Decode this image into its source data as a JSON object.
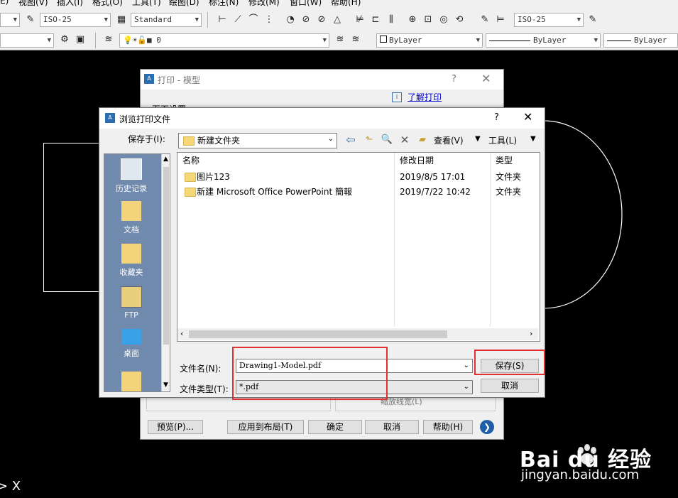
{
  "menu": {
    "items": [
      "E)",
      "视图(V)",
      "插入(I)",
      "格式(O)",
      "工具(T)",
      "绘图(D)",
      "标注(N)",
      "修改(M)",
      "窗口(W)",
      "帮助(H)"
    ]
  },
  "toolbar": {
    "text_style": "ISO-25",
    "table_style": "Standard",
    "dim_style": "ISO-25",
    "layer": "0",
    "color": "ByLayer",
    "linetype": "ByLayer",
    "lineweight": "ByLayer"
  },
  "print_dialog": {
    "title": "打印 - 模型",
    "help": "?",
    "learn_link": "了解打印",
    "partial_label": "页面设置",
    "partial_text": "缩放线宽(L)",
    "buttons": {
      "preview": "预览(P)...",
      "apply": "应用到布局(T)",
      "ok": "确定",
      "cancel": "取消",
      "help": "帮助(H)"
    }
  },
  "browse_dialog": {
    "title": "浏览打印文件",
    "help": "?",
    "save_in_label": "保存于(I):",
    "save_in_value": "新建文件夹",
    "views_label": "查看(V)",
    "tools_label": "工具(L)",
    "places": [
      {
        "label": "历史记录"
      },
      {
        "label": "文档"
      },
      {
        "label": "收藏夹"
      },
      {
        "label": "FTP"
      },
      {
        "label": "桌面"
      }
    ],
    "columns": [
      "名称",
      "修改日期",
      "类型"
    ],
    "files": [
      {
        "name": "图片123",
        "date": "2019/8/5 17:01",
        "type": "文件夹"
      },
      {
        "name": "新建 Microsoft Office PowerPoint 簡報",
        "date": "2019/7/22 10:42",
        "type": "文件夹"
      }
    ],
    "filename_label": "文件名(N):",
    "filename_value": "Drawing1-Model.pdf",
    "filetype_label": "文件类型(T):",
    "filetype_value": "*.pdf",
    "save_button": "保存(S)",
    "cancel_button": "取消"
  },
  "command": {
    "prompt": "> X"
  },
  "watermark": {
    "brand": "Bai du 经验",
    "url": "jingyan.baidu.com"
  },
  "colors": {
    "accent": "#e03030",
    "canvas": "#000000",
    "dialog": "#f0f0f0",
    "places_panel": "#6f8aad"
  }
}
